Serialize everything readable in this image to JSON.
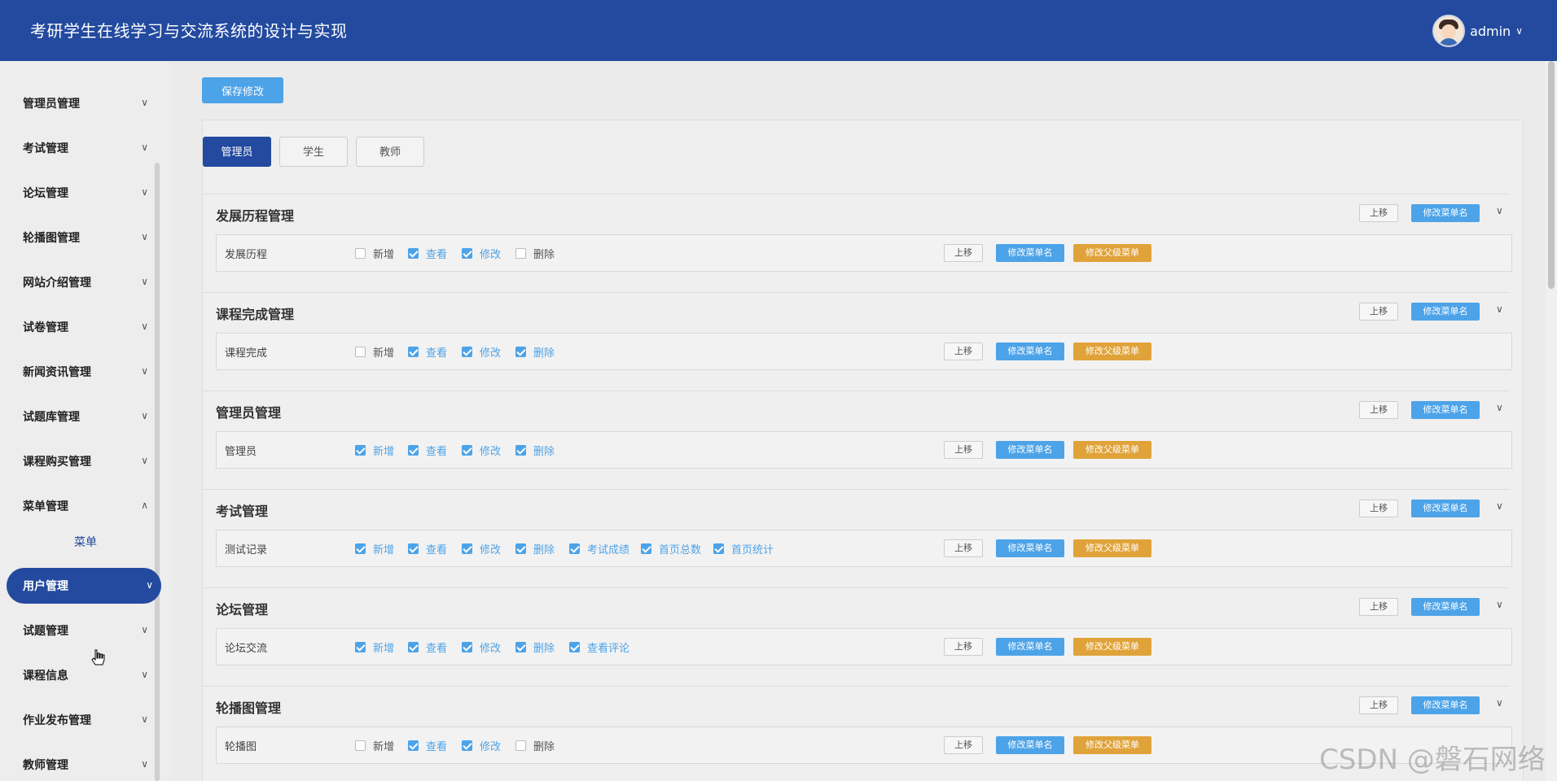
{
  "header": {
    "title": "考研学生在线学习与交流系统的设计与实现",
    "username": "admin",
    "caret": "∨"
  },
  "sidebar": {
    "items": [
      {
        "label": "管理员管理",
        "chevron": "∨"
      },
      {
        "label": "考试管理",
        "chevron": "∨"
      },
      {
        "label": "论坛管理",
        "chevron": "∨"
      },
      {
        "label": "轮播图管理",
        "chevron": "∨"
      },
      {
        "label": "网站介绍管理",
        "chevron": "∨"
      },
      {
        "label": "试卷管理",
        "chevron": "∨"
      },
      {
        "label": "新闻资讯管理",
        "chevron": "∨"
      },
      {
        "label": "试题库管理",
        "chevron": "∨"
      },
      {
        "label": "课程购买管理",
        "chevron": "∨"
      },
      {
        "label": "菜单管理",
        "chevron": "∧"
      },
      {
        "label": "用户管理",
        "chevron": "∨"
      },
      {
        "label": "试题管理",
        "chevron": "∨"
      },
      {
        "label": "课程信息",
        "chevron": "∨"
      },
      {
        "label": "作业发布管理",
        "chevron": "∨"
      },
      {
        "label": "教师管理",
        "chevron": "∨"
      }
    ],
    "submenu": {
      "label": "菜单"
    }
  },
  "toolbar": {
    "save_label": "保存修改"
  },
  "tabs": [
    {
      "label": "管理员"
    },
    {
      "label": "学生"
    },
    {
      "label": "教师"
    }
  ],
  "labels": {
    "move_up": "上移",
    "rename": "修改菜单名",
    "change_parent": "修改父级菜单",
    "toggle": "∨"
  },
  "groups": [
    {
      "title": "发展历程管理",
      "row": {
        "name": "发展历程",
        "perms": [
          {
            "label": "新增",
            "checked": false
          },
          {
            "label": "查看",
            "checked": true
          },
          {
            "label": "修改",
            "checked": true
          },
          {
            "label": "删除",
            "checked": false
          }
        ]
      }
    },
    {
      "title": "课程完成管理",
      "row": {
        "name": "课程完成",
        "perms": [
          {
            "label": "新增",
            "checked": false
          },
          {
            "label": "查看",
            "checked": true
          },
          {
            "label": "修改",
            "checked": true
          },
          {
            "label": "删除",
            "checked": true
          }
        ]
      }
    },
    {
      "title": "管理员管理",
      "row": {
        "name": "管理员",
        "perms": [
          {
            "label": "新增",
            "checked": true
          },
          {
            "label": "查看",
            "checked": true
          },
          {
            "label": "修改",
            "checked": true
          },
          {
            "label": "删除",
            "checked": true
          }
        ]
      }
    },
    {
      "title": "考试管理",
      "row": {
        "name": "测试记录",
        "perms": [
          {
            "label": "新增",
            "checked": true
          },
          {
            "label": "查看",
            "checked": true
          },
          {
            "label": "修改",
            "checked": true
          },
          {
            "label": "删除",
            "checked": true
          },
          {
            "label": "考试成绩",
            "checked": true
          },
          {
            "label": "首页总数",
            "checked": true
          },
          {
            "label": "首页统计",
            "checked": true
          }
        ]
      }
    },
    {
      "title": "论坛管理",
      "row": {
        "name": "论坛交流",
        "perms": [
          {
            "label": "新增",
            "checked": true
          },
          {
            "label": "查看",
            "checked": true
          },
          {
            "label": "修改",
            "checked": true
          },
          {
            "label": "删除",
            "checked": true
          },
          {
            "label": "查看评论",
            "checked": true
          }
        ]
      }
    },
    {
      "title": "轮播图管理",
      "row": {
        "name": "轮播图",
        "perms": [
          {
            "label": "新增",
            "checked": false
          },
          {
            "label": "查看",
            "checked": true
          },
          {
            "label": "修改",
            "checked": true
          },
          {
            "label": "删除",
            "checked": false
          }
        ]
      }
    }
  ],
  "watermark": "CSDN @磐石网络"
}
